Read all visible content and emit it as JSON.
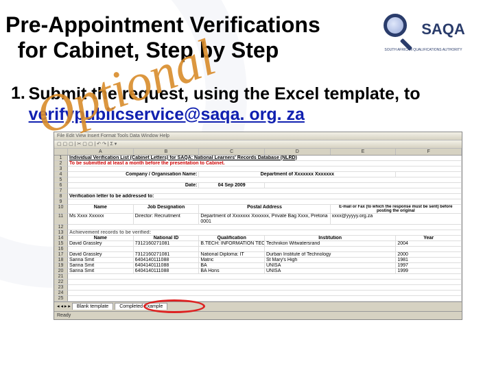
{
  "slide": {
    "title_line1": "Pre-Appointment Verifications",
    "title_line2": "for Cabinet, Step by Step",
    "watermark": "Optional",
    "step_number": "1.",
    "step_text_a": "Submit the request, using the Excel template, to ",
    "step_link": "verifypublicservice@saqa. org. za"
  },
  "logo": {
    "text": "SAQA",
    "subtext": "SOUTH AFRICAN QUALIFICATIONS AUTHORITY"
  },
  "excel": {
    "toolbar": {
      "menu_hint": "File  Edit  View  Insert  Format  Tools  Data  Window  Help"
    },
    "columns": [
      "",
      "A",
      "B",
      "C",
      "D",
      "E",
      "F"
    ],
    "row1_title": "Individual Verification List (Cabinet Letters) for SAQA: National Learners' Records Database (NLRD)",
    "row2_note": "To be submitted at least a month before the presentation to Cabinet.",
    "row4_company_label": "Company / Organisation Name:",
    "row4_dept": "Department of Xxxxxxx Xxxxxxx",
    "row6_date_label": "Date:",
    "row6_date": "04 Sep 2009",
    "row8_label": "Verification letter to be addressed to:",
    "headers_person": [
      "Name",
      "Job Designation",
      "Postal Address",
      "E-mail or Fax (to which the response must be sent) before posting the original"
    ],
    "row11": {
      "name": "Ms Xxxx Xxxxxx",
      "job": "Director: Recruitment",
      "address": "Department of Xxxxxxx Xxxxxxx, Private Bag Xxxx, Pretoria 0001",
      "email": "xxxx@yyyyy.org.za"
    },
    "row13_label": "Achievement records to be verified:",
    "headers_achiev": [
      "Name",
      "National ID",
      "Qualification",
      "Institution",
      "Year"
    ],
    "rows_achiev": [
      {
        "n": "15",
        "name": "David Grassley",
        "id": "7312160271081",
        "qual": "B.TECH: INFORMATION TECHNOLOGY",
        "inst": "Technikon Witwatersrand",
        "year": "2004"
      },
      {
        "n": "16",
        "name": "",
        "id": "",
        "qual": "",
        "inst": "",
        "year": ""
      },
      {
        "n": "17",
        "name": "David Grassley",
        "id": "7312160271081",
        "qual": "National Diploma: IT",
        "inst": "Durban Institute of Technology",
        "year": "2000"
      },
      {
        "n": "18",
        "name": "Sarina Smit",
        "id": "6404140111088",
        "qual": "Matric",
        "inst": "St Mary's High",
        "year": "1981"
      },
      {
        "n": "19",
        "name": "Sarina Smit",
        "id": "6404140111088",
        "qual": "BA",
        "inst": "UNISA",
        "year": "1997"
      },
      {
        "n": "20",
        "name": "Sarina Smit",
        "id": "6404140111088",
        "qual": "BA Hons",
        "inst": "UNISA",
        "year": "1999"
      }
    ],
    "blank_rows": [
      "21",
      "22",
      "23",
      "24",
      "25"
    ],
    "tabs": {
      "t1": "Blank template",
      "t2": "Completed Example"
    },
    "status": "Ready"
  }
}
